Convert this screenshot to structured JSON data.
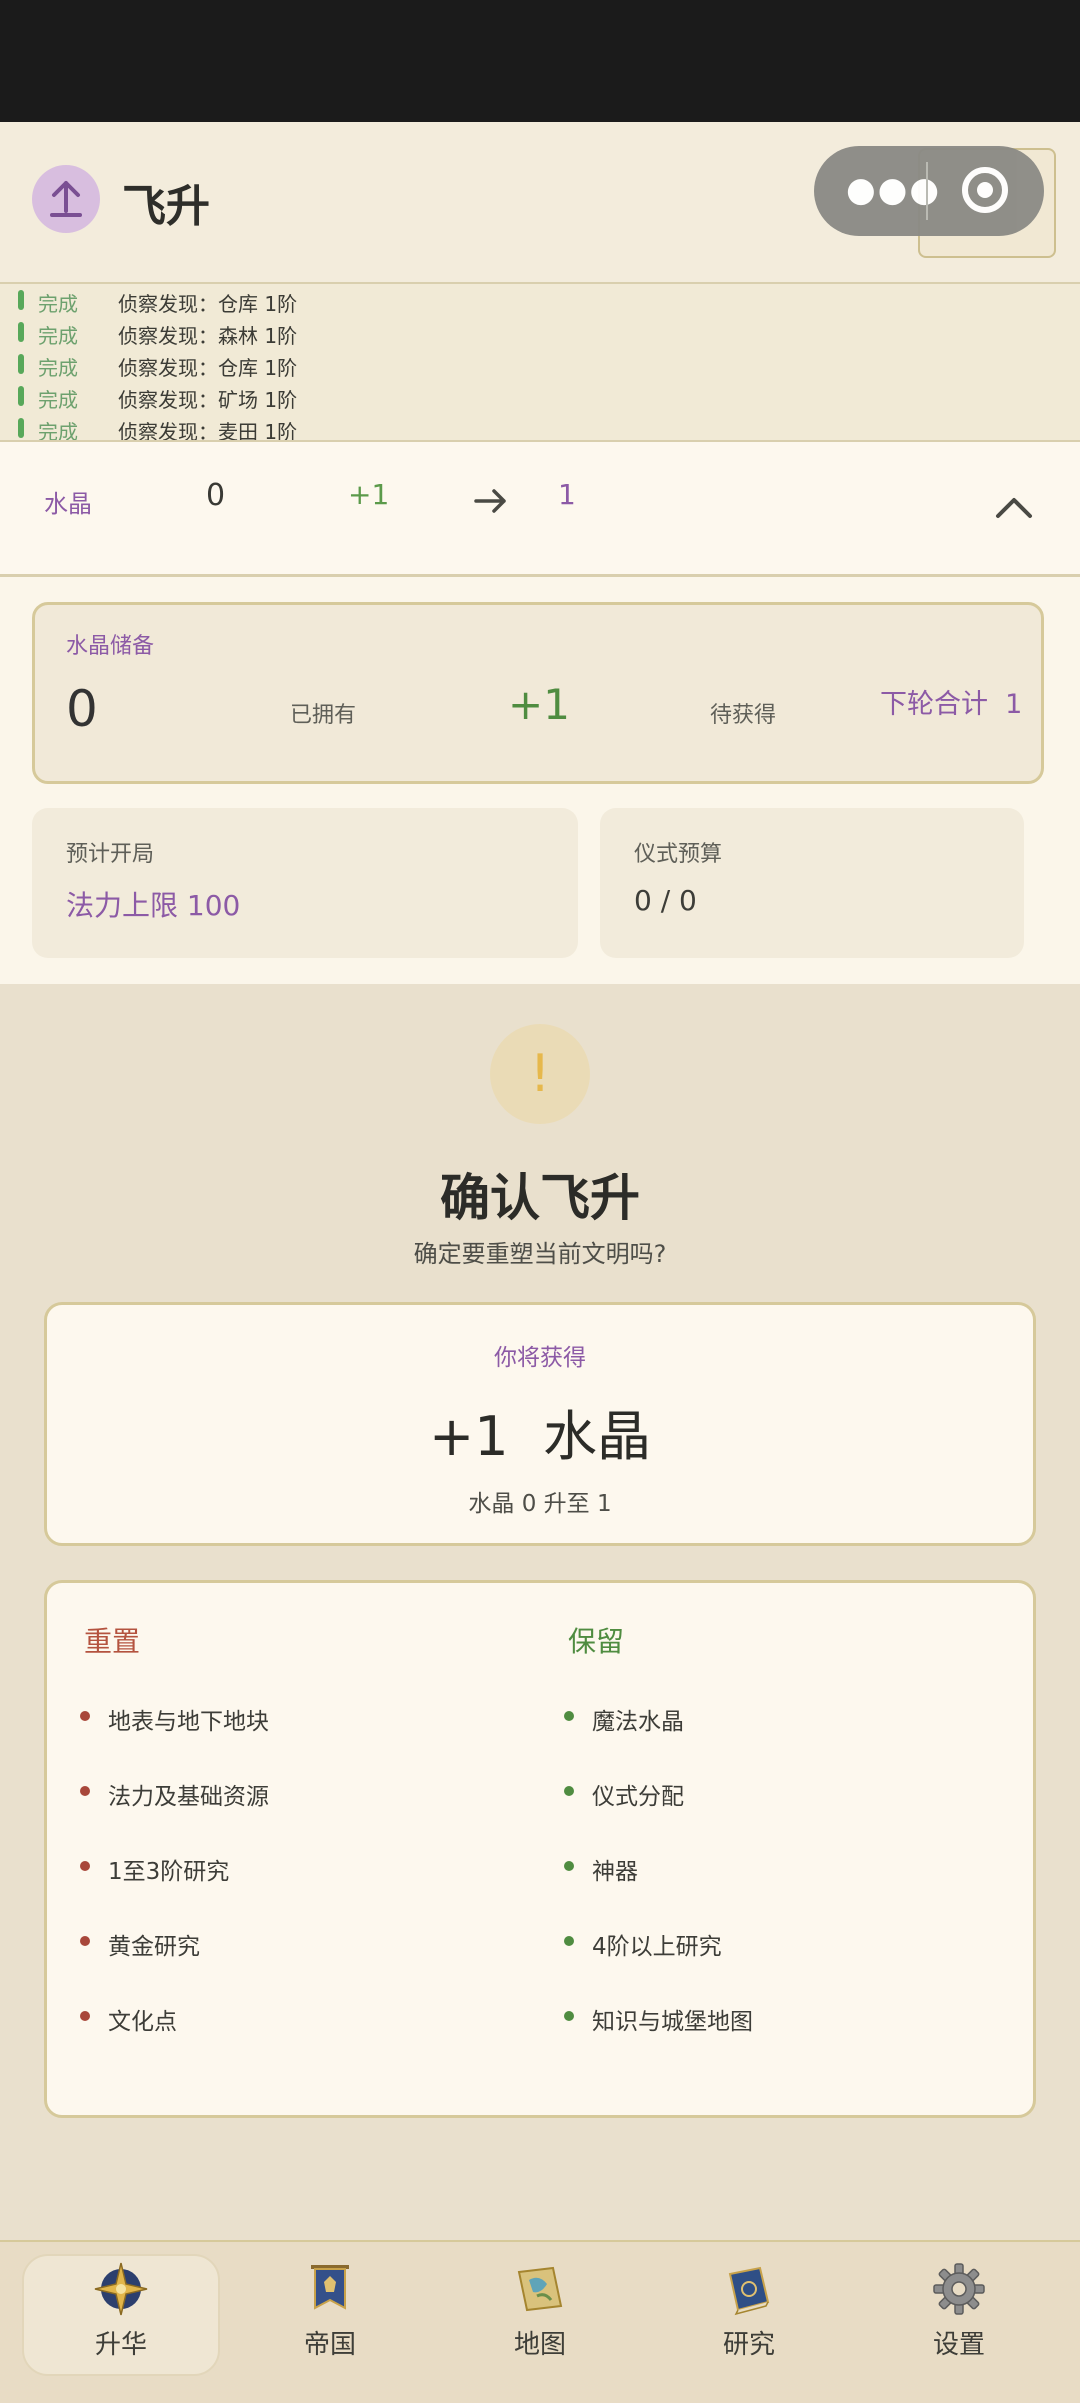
{
  "header": {
    "title": "飞升",
    "ghost_button": "关闭"
  },
  "log": [
    {
      "status": "完成",
      "text": "侦察发现：仓库 1阶"
    },
    {
      "status": "完成",
      "text": "侦察发现：森林 1阶"
    },
    {
      "status": "完成",
      "text": "侦察发现：仓库 1阶"
    },
    {
      "status": "完成",
      "text": "侦察发现：矿场 1阶"
    },
    {
      "status": "完成",
      "text": "侦察发现：麦田 1阶"
    }
  ],
  "conversion": {
    "label": "水晶",
    "from": "0",
    "gain": "+1",
    "to": "1"
  },
  "reserve": {
    "title": "水晶储备",
    "owned": "0",
    "owned_label": "已拥有",
    "pending": "+1",
    "pending_label": "待获得",
    "next_total": "下轮合计  1"
  },
  "start": {
    "label": "预计开局",
    "value": "法力上限 100"
  },
  "budget": {
    "label": "仪式预算",
    "value": "0 / 0"
  },
  "confirm": {
    "icon": "!",
    "title": "确认飞升",
    "subtitle": "确定要重塑当前文明吗?"
  },
  "gain": {
    "label": "你将获得",
    "value": "+1  水晶",
    "detail": "水晶 0 升至 1"
  },
  "reset": {
    "title": "重置",
    "items": [
      "地表与地下地块",
      "法力及基础资源",
      "1至3阶研究",
      "黄金研究",
      "文化点"
    ]
  },
  "keep": {
    "title": "保留",
    "items": [
      "魔法水晶",
      "仪式分配",
      "神器",
      "4阶以上研究",
      "知识与城堡地图"
    ]
  },
  "nav": [
    {
      "label": "升华",
      "icon": "compass-star-icon"
    },
    {
      "label": "帝国",
      "icon": "banner-icon"
    },
    {
      "label": "地图",
      "icon": "map-scroll-icon"
    },
    {
      "label": "研究",
      "icon": "spellbook-icon"
    },
    {
      "label": "设置",
      "icon": "gear-icon"
    }
  ],
  "colors": {
    "accent": "#8c5aa6",
    "positive": "#4f8c40",
    "negative": "#b4533f"
  }
}
